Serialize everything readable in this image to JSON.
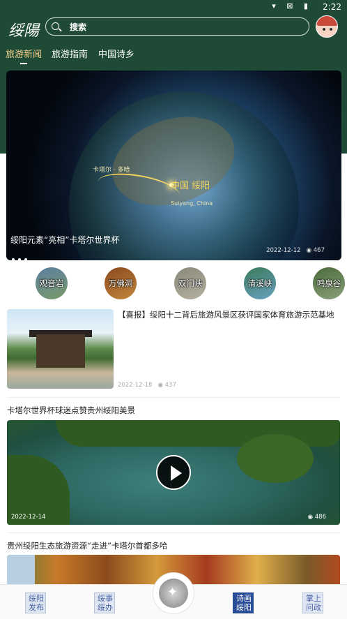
{
  "status_bar": {
    "time": "2:22",
    "icons": "▾ ⊠ ▮"
  },
  "app": {
    "logo": "绥陽"
  },
  "search": {
    "placeholder": "搜索"
  },
  "tabs": [
    {
      "label": "旅游新闻",
      "active": true
    },
    {
      "label": "旅游指南",
      "active": false
    },
    {
      "label": "中国诗乡",
      "active": false
    }
  ],
  "banner": {
    "caption": "绥阳元素“亮相”卡塔尔世界杯",
    "date": "2022-12-12",
    "views": "467",
    "map_label": "中国 绥阳",
    "map_sub": "Suiyang, China",
    "qatar_label": "卡塔尔 · 多哈"
  },
  "spots": [
    {
      "label": "观音岩",
      "colors": [
        "#5c7fa0",
        "#7a9a6a"
      ]
    },
    {
      "label": "万佛洞",
      "colors": [
        "#8a4a20",
        "#c2853a"
      ]
    },
    {
      "label": "双门峡",
      "colors": [
        "#8a8a7a",
        "#b5b0a0"
      ]
    },
    {
      "label": "清溪峡",
      "colors": [
        "#3a7a5a",
        "#6aa0c0"
      ]
    },
    {
      "label": "鸣泉谷",
      "colors": [
        "#4a6a3a",
        "#8aa07a"
      ]
    }
  ],
  "news": [
    {
      "title": "【喜报】绥阳十二背后旅游风景区获评国家体育旅游示范基地",
      "date": "2022-12-18",
      "views": "437"
    }
  ],
  "videos": [
    {
      "title": "卡塔尔世界杯球迷点赞贵州绥阳美景",
      "date": "2022-12-14",
      "views": "486"
    },
    {
      "title": "贵州绥阳生态旅游资源“走进”卡塔尔首都多哈"
    }
  ],
  "bottom_nav": [
    {
      "label": "绥阳\n发布",
      "active": false
    },
    {
      "label": "绥事\n绥办",
      "active": false
    },
    {
      "label": "诗画\n绥阳",
      "active": true
    },
    {
      "label": "掌上\n问政",
      "active": false
    }
  ],
  "colors": {
    "header": "#1f4a36",
    "accent_tab": "#f2d08a",
    "nav_active": "#284c96"
  }
}
